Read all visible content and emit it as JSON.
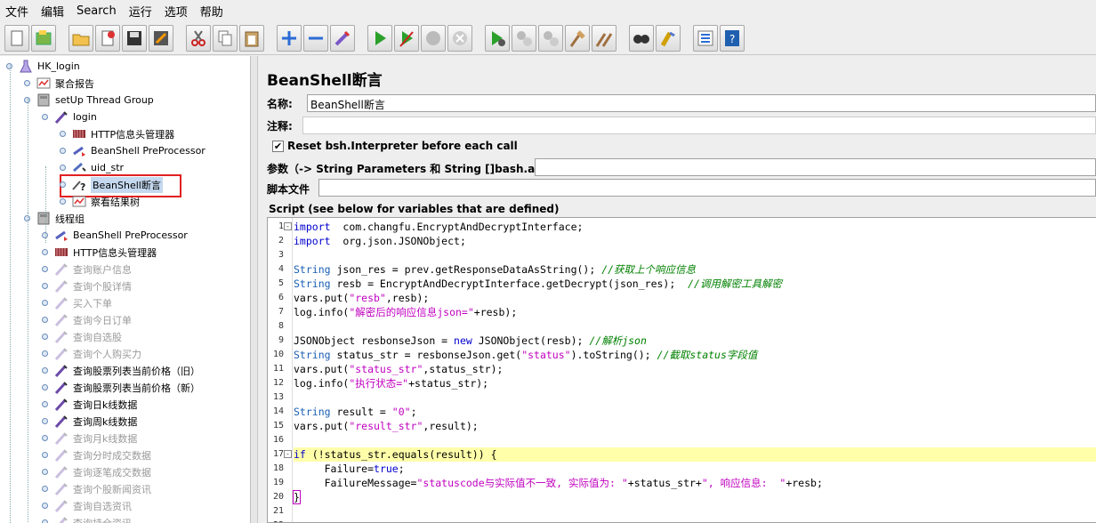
{
  "menu": [
    "文件",
    "编辑",
    "Search",
    "运行",
    "选项",
    "帮助"
  ],
  "toolbar_icons": [
    "new-icon",
    "templates-icon",
    "open-icon",
    "close-icon",
    "save-icon",
    "save-as-icon",
    "cut-icon",
    "copy-icon",
    "paste-icon",
    "expand-icon",
    "collapse-icon",
    "toggle-icon",
    "start-icon",
    "start-no-pause-icon",
    "stop-icon",
    "shutdown-icon",
    "remote-start-icon",
    "remote-stop-icon",
    "remote-shutdown-icon",
    "clear-icon",
    "clear-all-icon",
    "search-icon",
    "reset-search-icon",
    "function-helper-icon",
    "help-icon"
  ],
  "tree": [
    {
      "label": "HK_login",
      "indent": 0,
      "icon": "flask-icon",
      "dim": false
    },
    {
      "label": "聚合报告",
      "indent": 2,
      "icon": "report-icon",
      "dim": false
    },
    {
      "label": "setUp Thread Group",
      "indent": 2,
      "icon": "threadgroup-icon",
      "dim": false
    },
    {
      "label": "login",
      "indent": 3,
      "icon": "sampler-icon",
      "dim": false
    },
    {
      "label": "HTTP信息头管理器",
      "indent": 4,
      "icon": "header-manager-icon",
      "dim": false
    },
    {
      "label": "BeanShell PreProcessor",
      "indent": 4,
      "icon": "preprocessor-icon",
      "dim": false
    },
    {
      "label": "uid_str",
      "indent": 4,
      "icon": "extractor-icon",
      "dim": false
    },
    {
      "label": "BeanShell断言",
      "indent": 4,
      "icon": "assertion-icon",
      "dim": false,
      "selected": true
    },
    {
      "label": "察看结果树",
      "indent": 4,
      "icon": "report-icon",
      "dim": false
    },
    {
      "label": "线程组",
      "indent": 2,
      "icon": "threadgroup-icon",
      "dim": false
    },
    {
      "label": "BeanShell PreProcessor",
      "indent": 3,
      "icon": "preprocessor-icon",
      "dim": false
    },
    {
      "label": "HTTP信息头管理器",
      "indent": 3,
      "icon": "header-manager-icon",
      "dim": false
    },
    {
      "label": "查询账户信息",
      "indent": 3,
      "icon": "sampler-icon",
      "dim": true
    },
    {
      "label": "查询个股详情",
      "indent": 3,
      "icon": "sampler-icon",
      "dim": true
    },
    {
      "label": "买入下单",
      "indent": 3,
      "icon": "sampler-icon",
      "dim": true
    },
    {
      "label": "查询今日订单",
      "indent": 3,
      "icon": "sampler-icon",
      "dim": true
    },
    {
      "label": "查询自选股",
      "indent": 3,
      "icon": "sampler-icon",
      "dim": true
    },
    {
      "label": "查询个人购买力",
      "indent": 3,
      "icon": "sampler-icon",
      "dim": true
    },
    {
      "label": "查询股票列表当前价格（旧）",
      "indent": 3,
      "icon": "sampler-icon",
      "dim": false
    },
    {
      "label": "查询股票列表当前价格（新）",
      "indent": 3,
      "icon": "sampler-icon",
      "dim": false
    },
    {
      "label": "查询日k线数据",
      "indent": 3,
      "icon": "sampler-icon",
      "dim": false
    },
    {
      "label": "查询周k线数据",
      "indent": 3,
      "icon": "sampler-icon",
      "dim": false
    },
    {
      "label": "查询月k线数据",
      "indent": 3,
      "icon": "sampler-icon",
      "dim": true
    },
    {
      "label": "查询分时成交数据",
      "indent": 3,
      "icon": "sampler-icon",
      "dim": true
    },
    {
      "label": "查询逐笔成交数据",
      "indent": 3,
      "icon": "sampler-icon",
      "dim": true
    },
    {
      "label": "查询个股新闻资讯",
      "indent": 3,
      "icon": "sampler-icon",
      "dim": true
    },
    {
      "label": "查询自选资讯",
      "indent": 3,
      "icon": "sampler-icon",
      "dim": true
    },
    {
      "label": "查询持仓资讯",
      "indent": 3,
      "icon": "sampler-icon",
      "dim": true
    }
  ],
  "panel": {
    "title": "BeanShell断言",
    "name_label": "名称:",
    "name_value": "BeanShell断言",
    "comment_label": "注释:",
    "comment_value": "",
    "reset_label": "Reset bsh.Interpreter before each call",
    "reset_checked": true,
    "params_label": "参数（-> String Parameters 和 String []bash.args）",
    "params_value": "",
    "script_file_label": "脚本文件",
    "script_file_value": "",
    "script_label": "Script (see below for variables that are defined)"
  },
  "code_lines": [
    {
      "n": "1",
      "fold": "-",
      "parts": [
        [
          "kw",
          "import"
        ],
        [
          "",
          "  com.changfu.EncryptAndDecryptInterface;"
        ]
      ]
    },
    {
      "n": "2",
      "parts": [
        [
          "kw",
          "import"
        ],
        [
          "",
          "  org.json.JSONObject;"
        ]
      ]
    },
    {
      "n": "3",
      "parts": []
    },
    {
      "n": "4",
      "parts": [
        [
          "ty",
          "String"
        ],
        [
          "",
          " json_res = prev.getResponseDataAsString(); "
        ],
        [
          "cm",
          "//获取上个响应信息"
        ]
      ]
    },
    {
      "n": "5",
      "parts": [
        [
          "ty",
          "String"
        ],
        [
          "",
          " resb = EncryptAndDecryptInterface.getDecrypt(json_res);  "
        ],
        [
          "cm",
          "//调用解密工具解密"
        ]
      ]
    },
    {
      "n": "6",
      "parts": [
        [
          "",
          "vars.put("
        ],
        [
          "str",
          "\"resb\""
        ],
        [
          "",
          ",resb);"
        ]
      ]
    },
    {
      "n": "7",
      "parts": [
        [
          "",
          "log.info("
        ],
        [
          "str",
          "\"解密后的响应信息json=\""
        ],
        [
          "",
          "+resb);"
        ]
      ]
    },
    {
      "n": "8",
      "parts": []
    },
    {
      "n": "9",
      "parts": [
        [
          "",
          "JSONObject resbonseJson = "
        ],
        [
          "kw",
          "new"
        ],
        [
          "",
          " JSONObject(resb); "
        ],
        [
          "cm",
          "//解析json"
        ]
      ]
    },
    {
      "n": "10",
      "parts": [
        [
          "ty",
          "String"
        ],
        [
          "",
          " status_str = resbonseJson.get("
        ],
        [
          "str",
          "\"status\""
        ],
        [
          "",
          ").toString(); "
        ],
        [
          "cm",
          "//截取status字段值"
        ]
      ]
    },
    {
      "n": "11",
      "parts": [
        [
          "",
          "vars.put("
        ],
        [
          "str",
          "\"status_str\""
        ],
        [
          "",
          ",status_str);"
        ]
      ]
    },
    {
      "n": "12",
      "parts": [
        [
          "",
          "log.info("
        ],
        [
          "str",
          "\"执行状态=\""
        ],
        [
          "",
          "+status_str);"
        ]
      ]
    },
    {
      "n": "13",
      "parts": []
    },
    {
      "n": "14",
      "parts": [
        [
          "ty",
          "String"
        ],
        [
          "",
          " result = "
        ],
        [
          "str",
          "\"0\""
        ],
        [
          "",
          ";"
        ]
      ]
    },
    {
      "n": "15",
      "parts": [
        [
          "",
          "vars.put("
        ],
        [
          "str",
          "\"result_str\""
        ],
        [
          "",
          ",result);"
        ]
      ]
    },
    {
      "n": "16",
      "parts": []
    },
    {
      "n": "17",
      "fold": "-",
      "hl": true,
      "parts": [
        [
          "kw",
          "if"
        ],
        [
          "",
          " (!status_str.equals(result)) {"
        ]
      ]
    },
    {
      "n": "18",
      "parts": [
        [
          "",
          "     Failure="
        ],
        [
          "kw",
          "true"
        ],
        [
          "",
          ";"
        ]
      ]
    },
    {
      "n": "19",
      "parts": [
        [
          "",
          "     FailureMessage="
        ],
        [
          "str",
          "\"statuscode与实际值不一致, 实际值为: \""
        ],
        [
          "",
          "+status_str+"
        ],
        [
          "str",
          "\", 响应信息:  \""
        ],
        [
          "",
          "+resb;"
        ]
      ]
    },
    {
      "n": "20",
      "parts": [
        [
          "",
          "}"
        ]
      ]
    },
    {
      "n": "21",
      "parts": []
    },
    {
      "n": "22",
      "parts": []
    }
  ]
}
